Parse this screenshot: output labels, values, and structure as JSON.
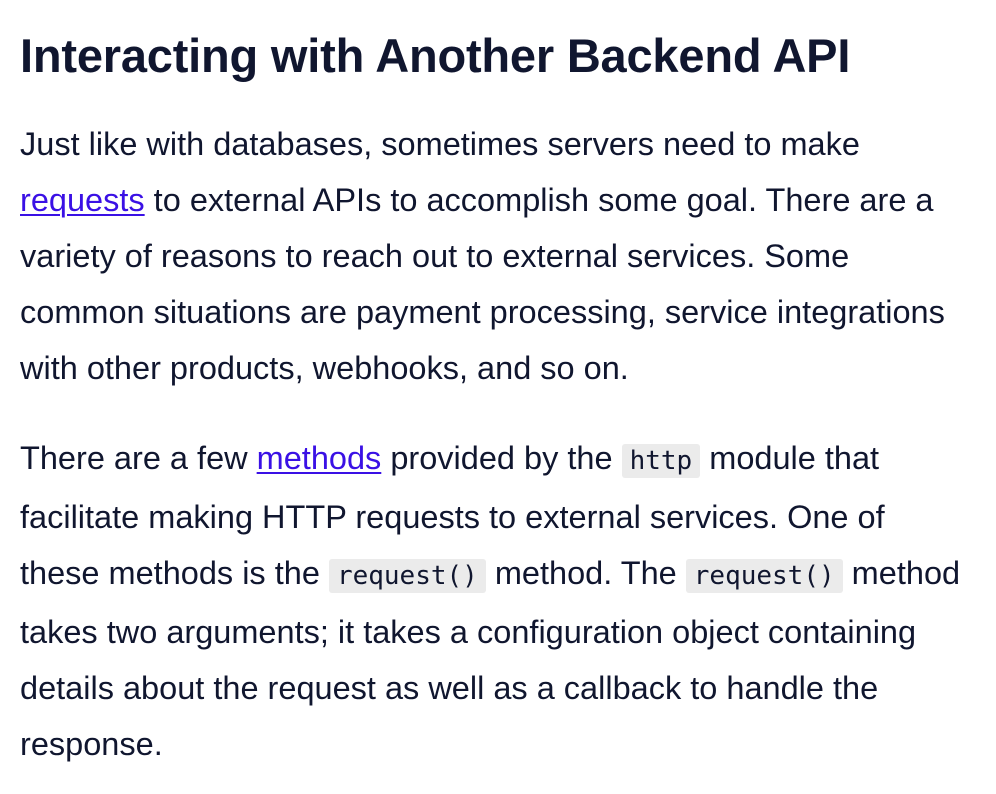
{
  "article": {
    "title": "Interacting with Another Backend API",
    "paragraph1": {
      "link_text": "requests",
      "before_link": "Just like with databases, sometimes servers need to make ",
      "after_link": " to external APIs to accomplish some goal. There are a variety of reasons to reach out to external services. Some common situations are payment processing, service integrations with other products, webhooks, and so on."
    },
    "paragraph2": {
      "text_1": "There are a few ",
      "link_text": "methods",
      "text_2": " provided by the ",
      "code_1": "http",
      "text_3": " module that facilitate making HTTP requests to external services. One of these methods is the ",
      "code_2": "request()",
      "text_4": " method. The ",
      "code_3": "request()",
      "text_5": " method takes two arguments; it takes a configuration object containing details about the request as well as a callback to handle the response."
    }
  }
}
